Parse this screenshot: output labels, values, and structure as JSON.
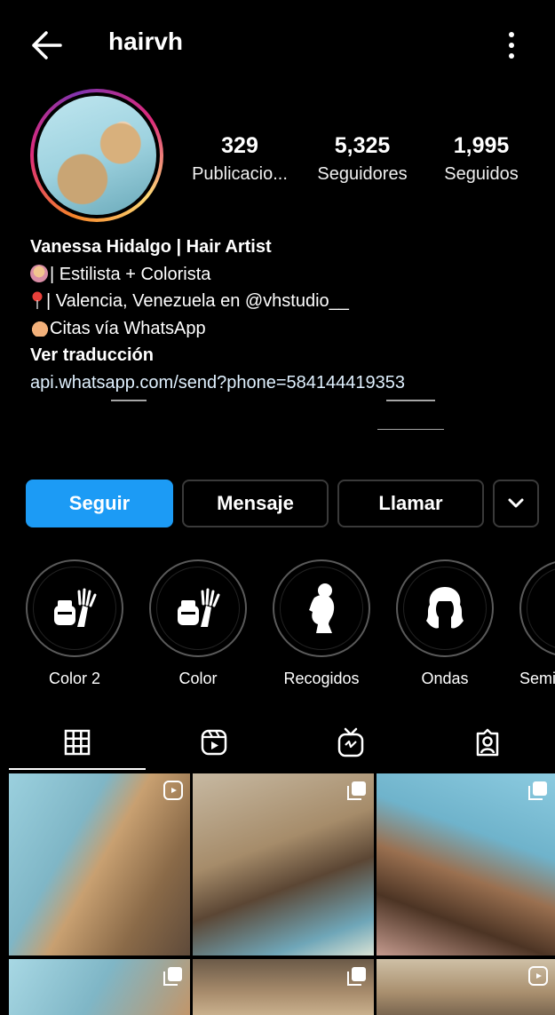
{
  "header": {
    "username": "hairvh"
  },
  "stats": [
    {
      "value": "329",
      "label": "Publicacio..."
    },
    {
      "value": "5,325",
      "label": "Seguidores"
    },
    {
      "value": "1,995",
      "label": "Seguidos"
    }
  ],
  "bio": {
    "name": "Vanessa Hidalgo | Hair Artist",
    "line1": "| Estilista + Colorista",
    "line2": "| Valencia, Venezuela en @vhstudio__",
    "line3": "Citas vía WhatsApp",
    "translate": "Ver traducción",
    "link": "api.whatsapp.com/send?phone=584144419353"
  },
  "actions": {
    "follow": "Seguir",
    "message": "Mensaje",
    "call": "Llamar"
  },
  "highlights": [
    {
      "label": "Color 2",
      "icon": "hair-dye-icon"
    },
    {
      "label": "Color",
      "icon": "hair-dye-icon"
    },
    {
      "label": "Recogidos",
      "icon": "updo-silhouette-icon"
    },
    {
      "label": "Ondas",
      "icon": "wavy-hair-icon"
    },
    {
      "label": "Semir",
      "icon": "highlight-icon"
    }
  ],
  "tabs": [
    "grid-icon",
    "reels-icon",
    "igtv-icon",
    "tagged-icon"
  ],
  "colors": {
    "accent": "#1c9bf5",
    "background": "#000000",
    "text": "#ffffff"
  }
}
